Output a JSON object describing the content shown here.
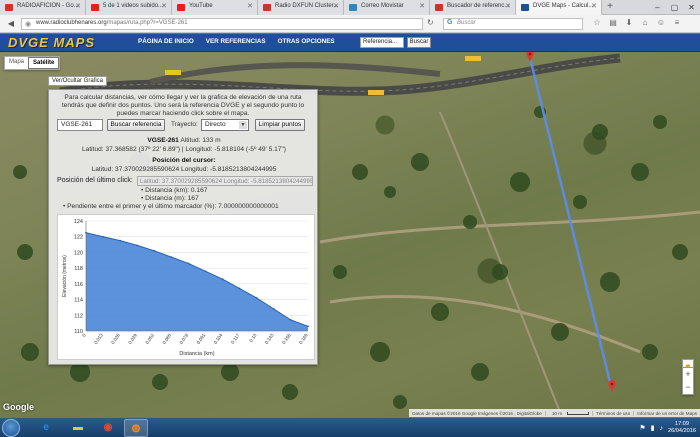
{
  "browser": {
    "tabs": [
      {
        "title": "RADIOAFICION - Go...",
        "color": "#d93025",
        "active": false
      },
      {
        "title": "5 de 1 videos subido...",
        "color": "#e62117",
        "active": false
      },
      {
        "title": "YouTube",
        "color": "#e62117",
        "active": false
      },
      {
        "title": "Radio DXFUN Cluster...",
        "color": "#c0392b",
        "active": false
      },
      {
        "title": "Correo Movistar",
        "color": "#2e86c1",
        "active": false
      },
      {
        "title": "Buscador de referenc...",
        "color": "#c0392b",
        "active": false
      },
      {
        "title": "DVGE Maps - Calcul...",
        "color": "#1f4f9a",
        "active": true
      }
    ],
    "url_host": "www.radioclubhenares.org",
    "url_path": "/mapas/ruta.php?r=VGSE-261",
    "search_placeholder": "Buscar"
  },
  "site": {
    "logo_text": "DVGE MAPS",
    "nav": [
      "PÁGINA DE INICIO",
      "VER REFERENCIAS",
      "OTRAS OPCIONES"
    ],
    "ref_input_value": "Referencia...",
    "ref_button": "Buscar"
  },
  "map": {
    "type_tabs": [
      {
        "label": "Mapa",
        "selected": false
      },
      {
        "label": "Satélite",
        "selected": true
      }
    ],
    "toggle_chart": "Ver/Ocultar Grafica",
    "google_label": "Google",
    "attribution": [
      "Datos de mapas ©2016 Google Imágenes ©2016 , DigitalGlobe",
      "10 m",
      "Términos de uso",
      "Informar de un error de Maps"
    ]
  },
  "panel": {
    "intro": "Para calcular distancias, ver cómo llegar y ver la grafica de elevación de una ruta tendrás que definir dos puntos. Uno será la referencia DVGE y el segundo punto lo puedes marcar haciendo click sobre el mapa.",
    "ref_value": "VGSE-261",
    "btn_find": "Buscar referencia",
    "trajectory_label": "Trayecto:",
    "trajectory_value": "Directo",
    "btn_clear": "Limpiar puntos",
    "ref_name": "VGSE-261",
    "altitude": "Altitud: 133 m",
    "ref_coords": "Latitud: 37.368582 (37º 22' 6.89\") | Longitud: -5.818104 (-5º 49' 5.17\")",
    "cursor_title": "Posición del cursor:",
    "cursor_coords": "Latitud: 37.370029285590624 Longitud: -5.8185213804244995",
    "last_click_label": "Posición del último click:",
    "last_click_value": "Latitud: 37.370029285590624 Longitud: -5.8185213804244995",
    "distance_km": "Distancia (km): 0.167",
    "distance_m": "Distancia (m): 167",
    "slope": "Pendiente entre el primer y el último marcador (%): 7.000000000000001"
  },
  "chart_data": {
    "type": "area",
    "ylabel": "Elevación (metros)",
    "xlabel": "Distancia (km)",
    "ylim": [
      110,
      124
    ],
    "yticks": [
      110,
      112,
      114,
      116,
      118,
      120,
      122,
      124
    ],
    "x": [
      0,
      0.013,
      0.026,
      0.039,
      0.052,
      0.065,
      0.078,
      0.091,
      0.104,
      0.117,
      0.13,
      0.143,
      0.156,
      0.169
    ],
    "x_labels": [
      "0",
      "0.013",
      "0.026",
      "0.039",
      "0.052",
      "0.065",
      "0.078",
      "0.091",
      "0.104",
      "0.117",
      "0.13",
      "0.143",
      "0.156",
      "0.169"
    ],
    "values": [
      122.5,
      122.0,
      121.5,
      120.9,
      120.2,
      119.4,
      118.6,
      117.6,
      116.6,
      115.4,
      114.2,
      112.8,
      111.4,
      110.6
    ],
    "grid": true,
    "fill_color": "#3f7fd6"
  },
  "taskbar": {
    "time": "17:09",
    "date": "26/04/2016"
  }
}
